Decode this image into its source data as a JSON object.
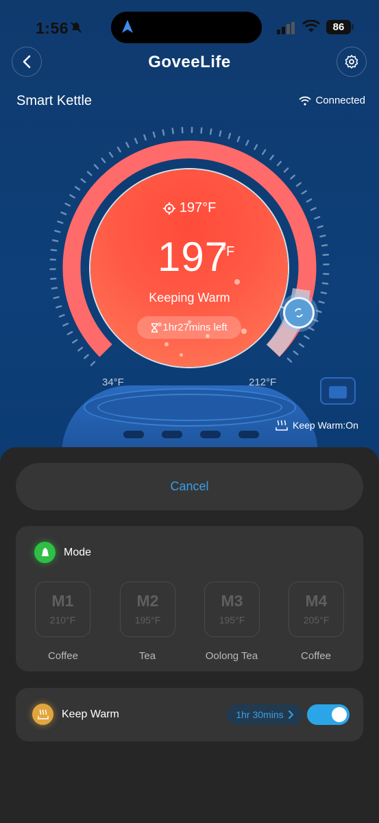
{
  "status_bar": {
    "time": "1:56",
    "battery": "86"
  },
  "header": {
    "brand": "GoveeLife"
  },
  "device": {
    "name": "Smart Kettle",
    "connection": "Connected"
  },
  "dial": {
    "target_temp": "197°F",
    "current_temp": "197",
    "unit": "°F",
    "state": "Keeping Warm",
    "time_left": "1hr27mins left",
    "min_label": "34°F",
    "max_label": "212°F",
    "keep_warm_status": "Keep Warm:On",
    "colors": {
      "arc": "#ff6b6b",
      "disc": "#ff5a45",
      "background": "#0f3a6e"
    }
  },
  "sheet": {
    "cancel_label": "Cancel",
    "mode": {
      "title": "Mode",
      "items": [
        {
          "code": "M1",
          "temp": "210°F",
          "name": "Coffee"
        },
        {
          "code": "M2",
          "temp": "195°F",
          "name": "Tea"
        },
        {
          "code": "M3",
          "temp": "195°F",
          "name": "Oolong Tea"
        },
        {
          "code": "M4",
          "temp": "205°F",
          "name": "Coffee"
        }
      ]
    },
    "keep_warm": {
      "title": "Keep Warm",
      "duration": "1hr 30mins",
      "enabled": true
    }
  }
}
